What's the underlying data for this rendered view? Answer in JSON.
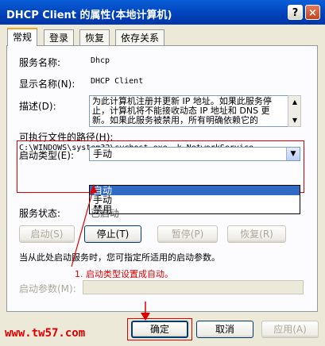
{
  "window": {
    "title": "DHCP Client 的属性(本地计算机)",
    "help_button": "?",
    "close_button": "×"
  },
  "tabs": [
    "常规",
    "登录",
    "恢复",
    "依存关系"
  ],
  "general": {
    "service_name_label": "服务名称:",
    "service_name_value": "Dhcp",
    "display_name_label": "显示名称(N):",
    "display_name_value": "DHCP Client",
    "description_label": "描述(D):",
    "description_value": "为此计算机注册并更新 IP 地址。如果此服务停止，计算机将不能接收动态 IP 地址和 DNS 更新。如果此服务被禁用，所有明确依赖它的",
    "path_label": "可执行文件的路径(H):",
    "path_value": "C:\\WINDOWS\\system32\\svchost.exe -k NetworkService",
    "startup_type_label": "启动类型(E):",
    "startup_type_selected": "手动",
    "startup_type_options": [
      "自动",
      "手动",
      "禁用"
    ],
    "service_status_label": "服务状态:",
    "service_status_value": "已启动",
    "start_button": "启动(S)",
    "stop_button": "停止(T)",
    "pause_button": "暂停(P)",
    "resume_button": "恢复(R)",
    "hint_text": "当从此处启动服务时，您可指定所适用的启动参数。",
    "start_params_label": "启动参数(M):"
  },
  "annotation": {
    "note": "1. 启动类型设置成自动。"
  },
  "footer": {
    "ok_button": "确定",
    "cancel_button": "取消",
    "apply_button": "应用(A)"
  },
  "watermark": "www.tw57.com",
  "colors": {
    "titlebar": "#0040b8",
    "selection": "#316ac5",
    "annotation": "#dd0000"
  }
}
